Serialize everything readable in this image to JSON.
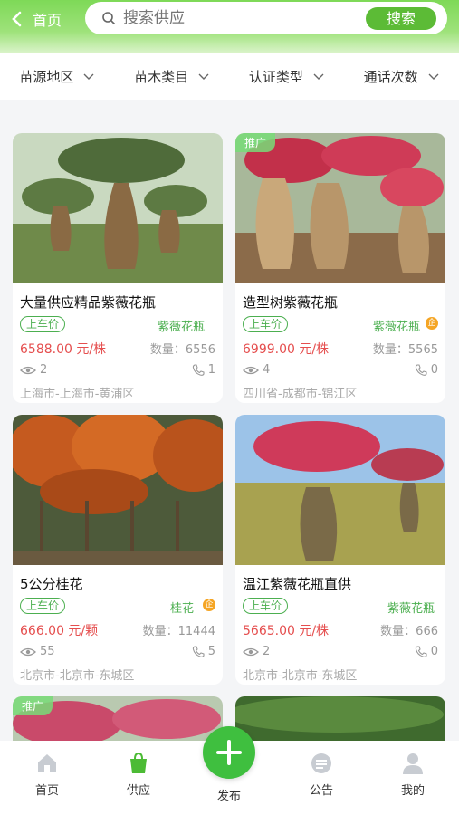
{
  "header": {
    "back_label": "首页",
    "search_placeholder": "搜索供应",
    "search_button": "搜索"
  },
  "filters": [
    {
      "label": "苗源地区"
    },
    {
      "label": "苗木类目"
    },
    {
      "label": "认证类型"
    },
    {
      "label": "通话次数"
    }
  ],
  "cards": [
    {
      "title": "大量供应精品紫薇花瓶",
      "tag": "上车价",
      "category": "紫薇花瓶",
      "price": "6588.00 元/株",
      "qty": "数量：6556",
      "views": "2",
      "calls": "1",
      "address": "上海市-上海市-黄浦区"
    },
    {
      "title": "造型树紫薇花瓶",
      "tag": "上车价",
      "category": "紫薇花瓶",
      "promo": "推广",
      "price": "6999.00 元/株",
      "qty": "数量：5565",
      "views": "4",
      "calls": "0",
      "address": "四川省-成都市-锦江区"
    },
    {
      "title": "5公分桂花",
      "tag": "上车价",
      "category": "桂花",
      "price": "666.00 元/颗",
      "qty": "数量：11444",
      "views": "55",
      "calls": "5",
      "address": "北京市-北京市-东城区"
    },
    {
      "title": "温江紫薇花瓶直供",
      "tag": "上车价",
      "category": "紫薇花瓶",
      "price": "5665.00 元/株",
      "qty": "数量：666",
      "views": "2",
      "calls": "0",
      "address": "北京市-北京市-东城区"
    },
    {
      "promo": "推广"
    }
  ],
  "tabbar": {
    "home": "首页",
    "supply": "供应",
    "post": "发布",
    "notice": "公告",
    "mine": "我的"
  },
  "colors": {
    "accent": "#5cbb36",
    "price": "#e54e4e",
    "tag": "#4caf50"
  }
}
